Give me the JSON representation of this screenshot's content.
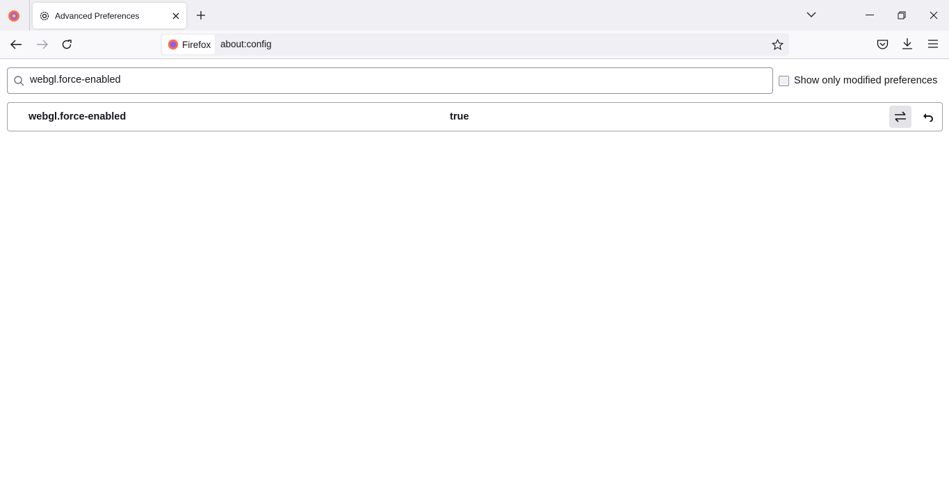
{
  "tab": {
    "title": "Advanced Preferences"
  },
  "urlbar": {
    "identity_label": "Firefox",
    "url": "about:config"
  },
  "search": {
    "value": "webgl.force-enabled"
  },
  "filter": {
    "label": "Show only modified preferences",
    "checked": false
  },
  "preferences": [
    {
      "name": "webgl.force-enabled",
      "value": "true"
    }
  ],
  "colors": {
    "accent": "#0061e0",
    "tabbar_bg": "#f0f0f4"
  }
}
